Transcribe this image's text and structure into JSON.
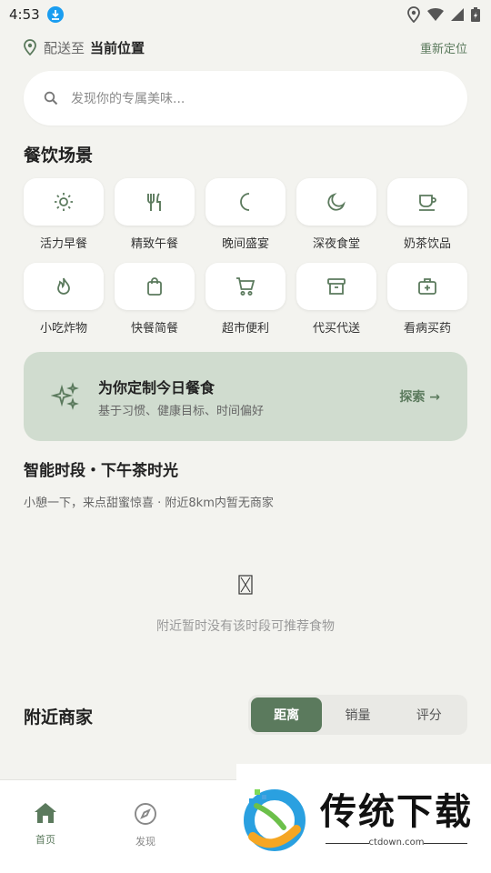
{
  "status_bar": {
    "time": "4:53"
  },
  "location": {
    "label": "配送至",
    "value": "当前位置",
    "relocate": "重新定位"
  },
  "search": {
    "placeholder": "发现你的专属美味..."
  },
  "scenes": {
    "title": "餐饮场景",
    "row1": [
      {
        "label": "活力早餐",
        "icon": "sun-icon"
      },
      {
        "label": "精致午餐",
        "icon": "fork-knife-icon"
      },
      {
        "label": "晚间盛宴",
        "icon": "moon-icon"
      },
      {
        "label": "深夜食堂",
        "icon": "crescent-moon-icon"
      },
      {
        "label": "奶茶饮品",
        "icon": "cup-icon"
      }
    ],
    "row2": [
      {
        "label": "小吃炸物",
        "icon": "flame-icon"
      },
      {
        "label": "快餐简餐",
        "icon": "shopping-bag-icon"
      },
      {
        "label": "超市便利",
        "icon": "cart-icon"
      },
      {
        "label": "代买代送",
        "icon": "archive-box-icon"
      },
      {
        "label": "看病买药",
        "icon": "medical-kit-icon"
      }
    ]
  },
  "promo": {
    "title": "为你定制今日餐食",
    "subtitle": "基于习惯、健康目标、时间偏好",
    "action": "探索 →",
    "icon": "sparkles-icon"
  },
  "smart": {
    "title": "智能时段・下午茶时光",
    "subtitle": "小憩一下，来点甜蜜惊喜 · 附近8km内暂无商家",
    "empty_text": "附近暂时没有该时段可推荐食物"
  },
  "nearby": {
    "title": "附近商家",
    "sort_options": [
      "距离",
      "销量",
      "评分"
    ],
    "active_sort": "距离"
  },
  "bottom_nav": {
    "items": [
      {
        "label": "首页",
        "icon": "home-icon"
      },
      {
        "label": "发现",
        "icon": "compass-icon"
      }
    ]
  },
  "watermark": {
    "title": "传统下载",
    "url": "ctdown.com"
  },
  "colors": {
    "accent": "#5b7a5d",
    "background": "#f3f3ef",
    "promo_bg": "#d0dccf"
  }
}
